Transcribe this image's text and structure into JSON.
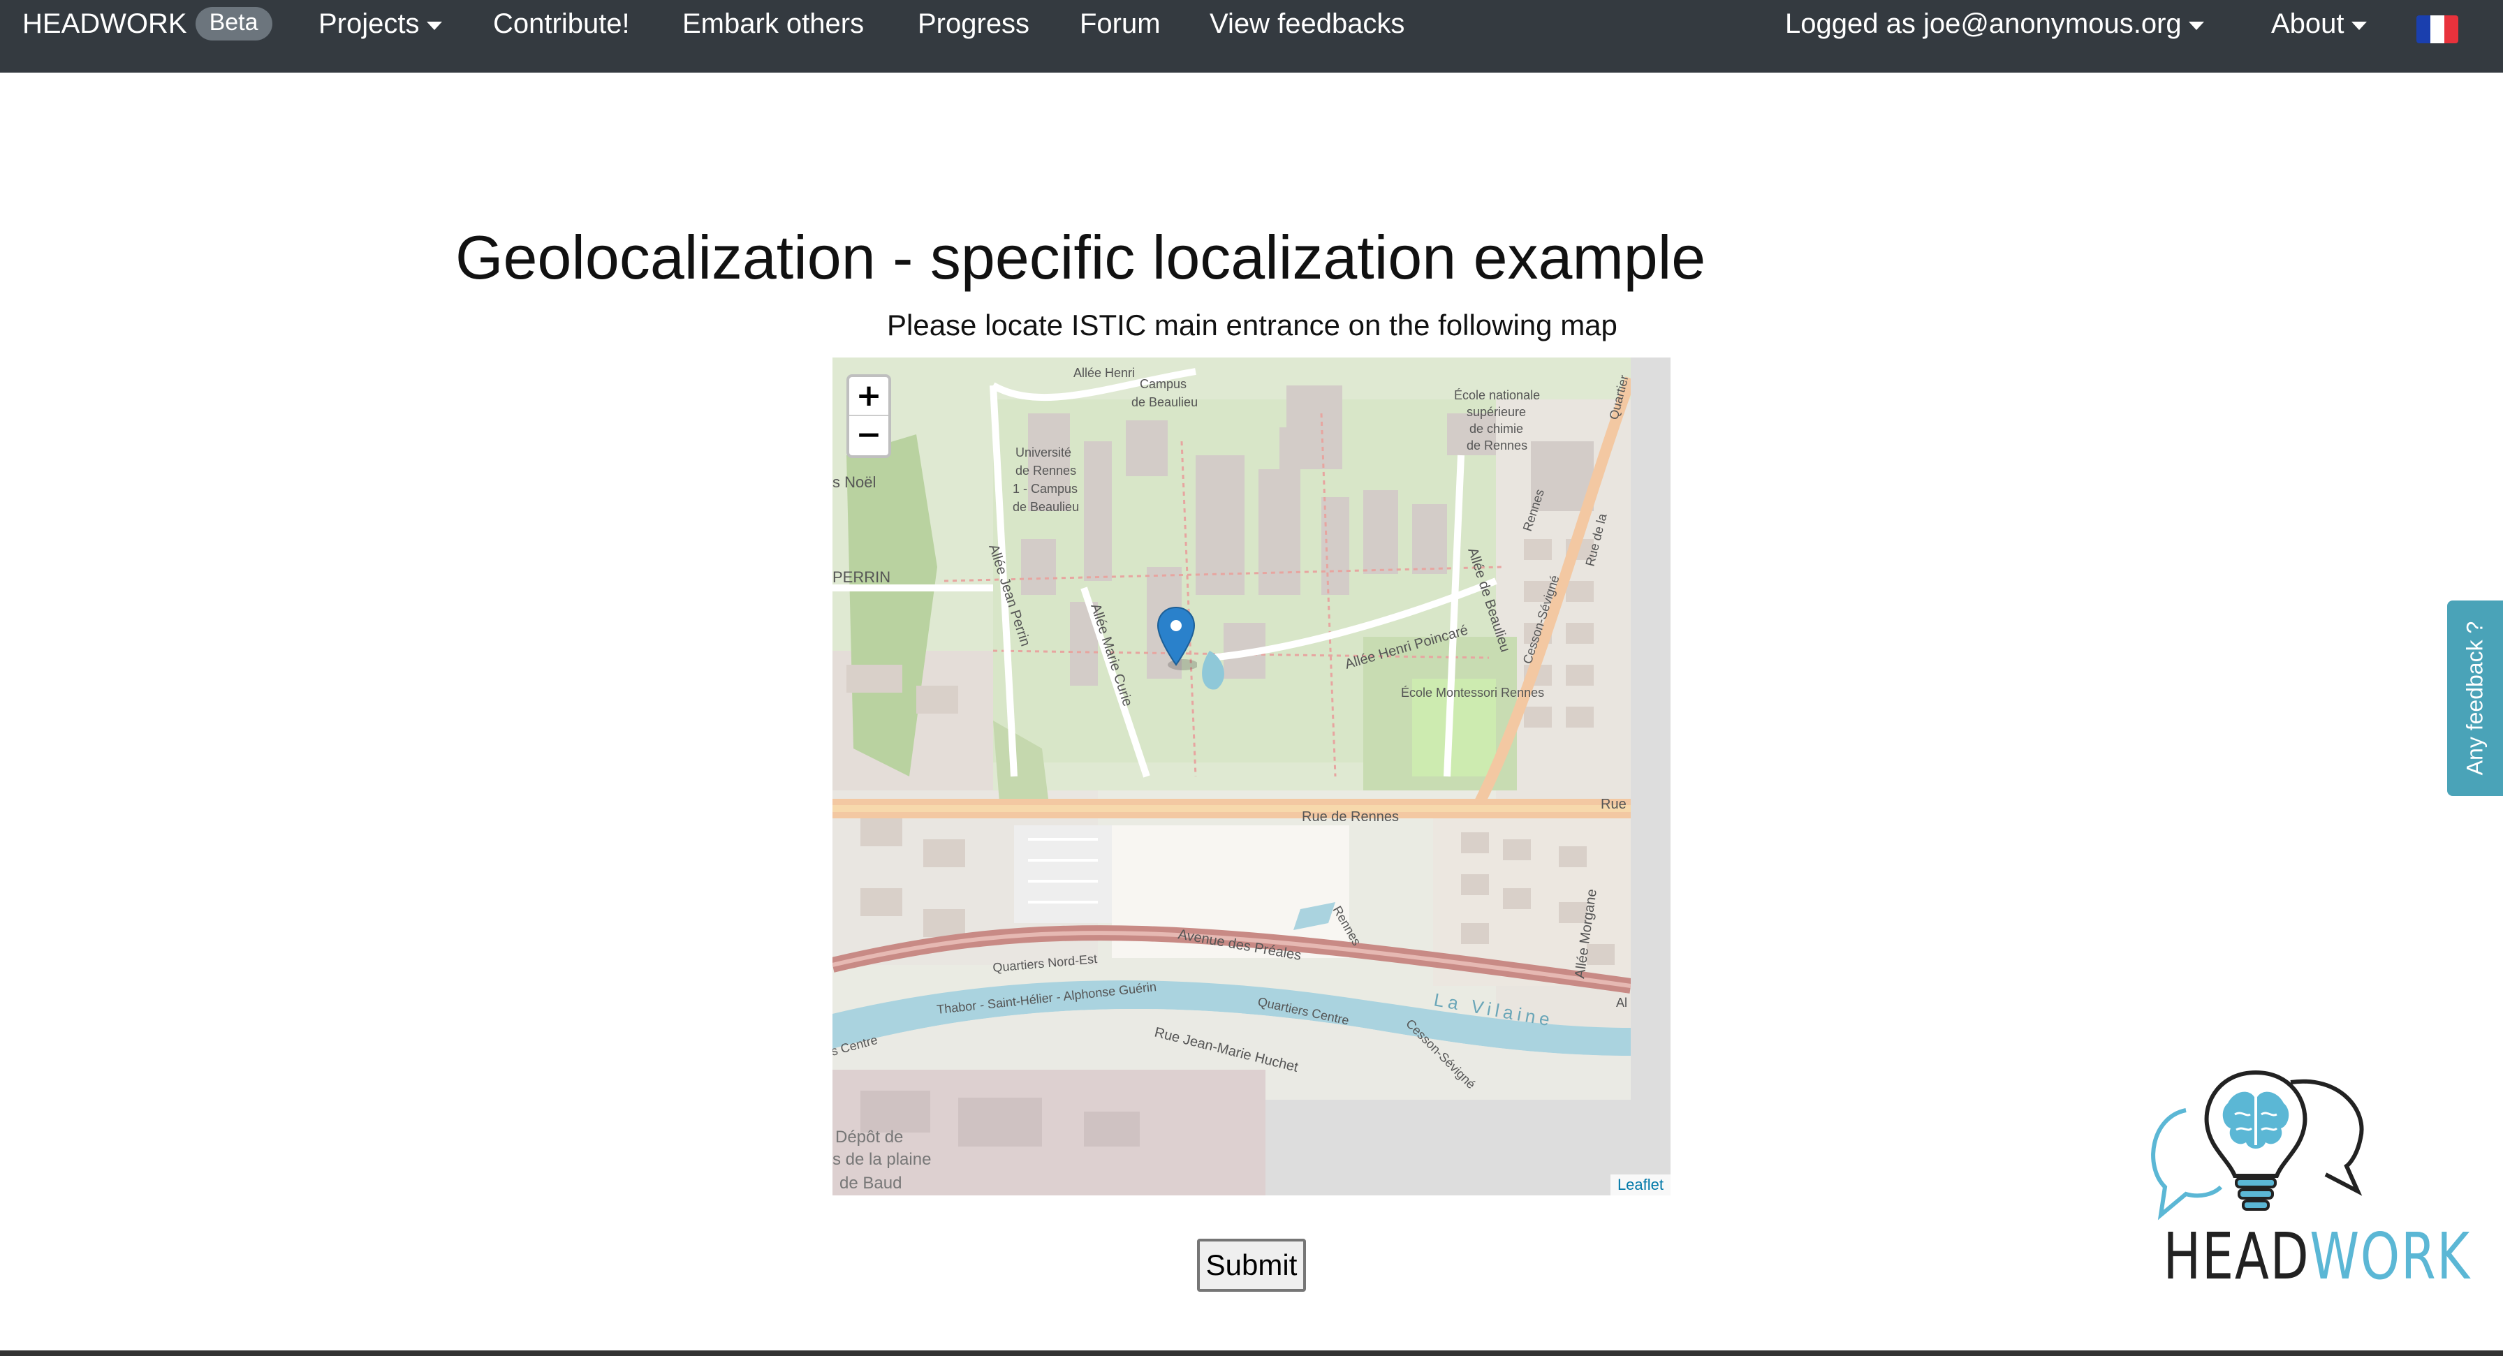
{
  "navbar": {
    "brand": "HEADWORK",
    "badge": "Beta",
    "items": [
      {
        "label": "Projects",
        "dropdown": true
      },
      {
        "label": "Contribute!"
      },
      {
        "label": "Embark others"
      },
      {
        "label": "Progress"
      },
      {
        "label": "Forum"
      },
      {
        "label": "View feedbacks"
      }
    ],
    "user_menu": "Logged as joe@anonymous.org",
    "about": "About",
    "language_icon": "france-flag-icon",
    "colors": {
      "background": "#343a40",
      "badge": "#6c757d"
    }
  },
  "page": {
    "title": "Geolocalization - specific localization example",
    "instruction": "Please locate ISTIC main entrance on the following map"
  },
  "map": {
    "zoom_in": "+",
    "zoom_out": "−",
    "attribution": "Leaflet",
    "labels": {
      "allee_henri": "Allée Henri",
      "campus": "Campus",
      "de_beaulieu": "de Beaulieu",
      "ecole_nationale": "École nationale",
      "superieure": "supérieure",
      "de_chimie": "de chimie",
      "de_rennes": "de Rennes",
      "universite": "Université",
      "de_rennes2": "de Rennes",
      "campus1": "1 - Campus",
      "de_beaulieu2": "de Beaulieu",
      "noel": "s Noël",
      "perrin": "PERRIN",
      "allee_jean_perrin": "Allée Jean Perrin",
      "allee_marie_curie": "Allée Marie Curie",
      "allee_henri_poincare": "Allée Henri Poincaré",
      "allee_de_beaulieu": "Allée de Beaulieu",
      "rennes_side": "Rennes",
      "cesson_sevigne": "Cesson-Sévigné",
      "rue_de_la": "Rue de la",
      "quartier": "Quartier",
      "ecole_montessori": "École Montessori Rennes",
      "rue_de_rennes": "Rue de Rennes",
      "rue_right": "Rue",
      "allee_morgane": "Allée Morgane",
      "rennes_river": "Rennes",
      "avenue_des_pres": "Avenue des Préales",
      "quartiers_nord_est": "Quartiers Nord-Est",
      "thabor": "Thabor - Saint-Hélier - Alphonse Guérin",
      "quartiers_centre": "Quartiers Centre",
      "la_vilaine": "La Vilaine",
      "cesson_sevigne2": "Cesson-Sévigné",
      "centre_left": "s Centre",
      "rue_jean_marie": "Rue Jean-Marie Huchet",
      "depot_de": "Dépôt de",
      "de_la_plaine": "s de la plaine",
      "de_baud": "de Baud",
      "al": "Al"
    },
    "marker_icon": "map-marker-icon",
    "colors": {
      "marker": "#2a81cb",
      "water": "#aad3df",
      "park": "#cdebb0",
      "road": "#f7d9ac"
    }
  },
  "submit": {
    "label": "Submit"
  },
  "feedback_tab": {
    "label": "Any feedback ?",
    "color": "#4aa3b8"
  },
  "logo": {
    "head": "HEAD",
    "work": "WORK"
  }
}
